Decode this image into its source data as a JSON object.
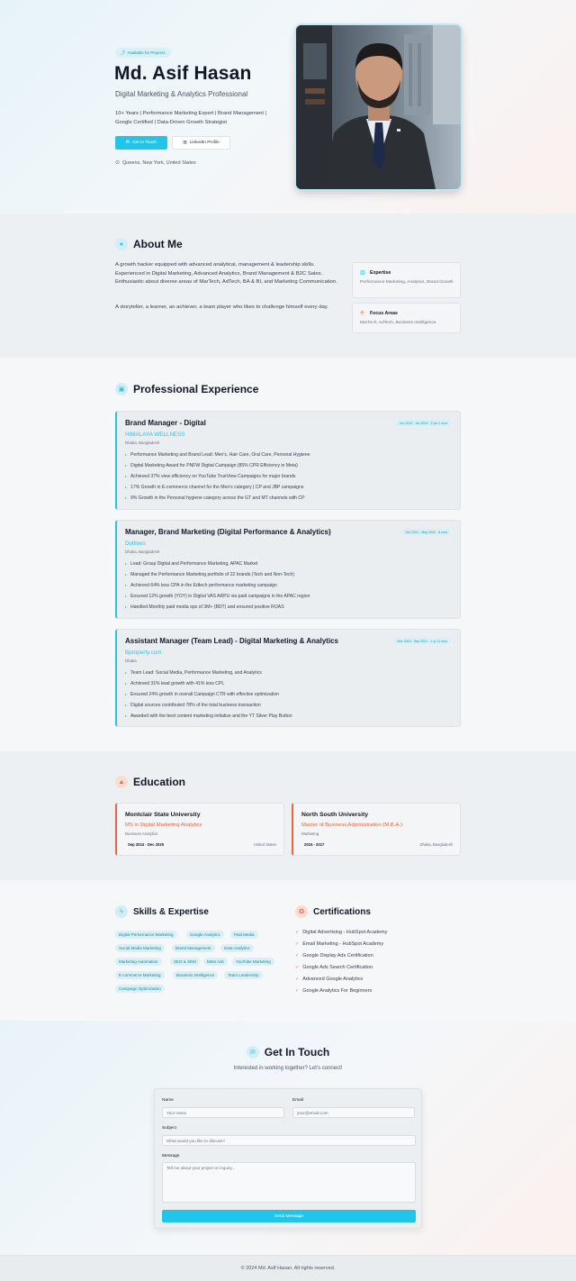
{
  "hero": {
    "badge": "Available for Projects",
    "name": "Md. Asif Hasan",
    "role": "Digital Marketing & Analytics Professional",
    "tagline": "10+ Years | Performance Marketing Expert | Brand Management | Google Certified | Data-Driven Growth Strategist",
    "cta_primary": "Get In Touch",
    "cta_secondary": "LinkedIn Profile",
    "location": "Queens, New York, United States"
  },
  "about": {
    "title": "About Me",
    "p1": "A growth hacker equipped with advanced analytical, management & leadership skills. Experienced in Digital Marketing, Advanced Analytics, Brand Management & B2C Sales. Enthusiastic about diverse areas of MarTech, AdTech, BA & BI, and Marketing Communication.",
    "p2": "A storyteller, a learner, an achiever, a team player who likes to challenge himself every day.",
    "cards": [
      {
        "title": "Expertise",
        "desc": "Performance Marketing, Analytics, Brand Growth"
      },
      {
        "title": "Focus Areas",
        "desc": "MarTech, AdTech, Business Intelligence"
      }
    ]
  },
  "experience": {
    "title": "Professional Experience",
    "jobs": [
      {
        "title": "Brand Manager - Digital",
        "company": "HIMALAYA WELLNESS",
        "location": "Dhaka, Bangladesh",
        "dates": "Jun 2022 - Jul 2024 · 2 yrs 2 mos",
        "bullets": [
          "Performance Marketing and Brand Lead: Men's, Hair Care, Oral Care, Personal Hygiene",
          "Digital Marketing Award for PNFW Digital Campaign (85% CPR Efficiency in Meta)",
          "Achieved 37% view efficiency on YouTube TrueView Campaigns for major brands",
          "17% Growth in E-commerce channel for the Men's category | CP and JBP campaigns",
          "9% Growth in the Personal hygiene category across the GT and MT channels with CP"
        ]
      },
      {
        "title": "Manager, Brand Marketing (Digital Performance & Analytics)",
        "company": "Dotlines",
        "location": "Dhaka, Bangladesh",
        "dates": "Oct 2021 - May 2022 · 8 mos",
        "bullets": [
          "Lead: Group Digital and Performance Marketing, APAC Market",
          "Managed the Performance Marketing portfolio of 22 brands (Tech and Non-Tech)",
          "Achieved 64% less CPA in the Edtech performance marketing campaign",
          "Ensured 12% growth (YOY) in Digital VAS ARPU via paid campaigns in the APAC region",
          "Handled Monthly paid media ops of 3M+ (BDT) and ensured positive ROAS"
        ]
      },
      {
        "title": "Assistant Manager (Team Lead) - Digital Marketing & Analytics",
        "company": "Bproperty.com",
        "location": "Dhaka",
        "dates": "Nov 2019 - Sep 2021 · 1 yr 11 mos",
        "bullets": [
          "Team Lead: Social Media, Performance Marketing, and Analytics",
          "Achieved 31% lead growth with 41% less CPL",
          "Ensured 24% growth in overall Campaign CTR with effective optimization",
          "Digital sources contributed 78% of the total business transaction",
          "Awarded with the best content marketing initiative and the YT Silver Play Button"
        ]
      }
    ]
  },
  "education": {
    "title": "Education",
    "items": [
      {
        "school": "Montclair State University",
        "degree": "MS in Digital Marketing Analytics",
        "field": "Business Analytics",
        "years": "Sep 2024 - Dec 2025",
        "place": "United States"
      },
      {
        "school": "North South University",
        "degree": "Master of Business Administration (M.B.A.)",
        "field": "Marketing",
        "years": "2015 - 2017",
        "place": "Dhaka, Bangladesh"
      }
    ]
  },
  "skills": {
    "title": "Skills & Expertise",
    "items": [
      "Digital Performance Marketing",
      "Google Analytics",
      "Paid Media",
      "Social Media Marketing",
      "Brand Management",
      "Data Analytics",
      "Marketing Automation",
      "SEO & SEM",
      "Meta Ads",
      "YouTube Marketing",
      "E-commerce Marketing",
      "Business Intelligence",
      "Team Leadership",
      "Campaign Optimization"
    ]
  },
  "certifications": {
    "title": "Certifications",
    "items": [
      "Digital Advertising - HubSpot Academy",
      "Email Marketing - HubSpot Academy",
      "Google Display Ads Certification",
      "Google Ads Search Certification",
      "Advanced Google Analytics",
      "Google Analytics For Beginners"
    ]
  },
  "contact": {
    "title": "Get In Touch",
    "subtitle": "Interested in working together? Let's connect!",
    "name_label": "Name",
    "name_placeholder": "Your name",
    "email_label": "Email",
    "email_placeholder": "your@email.com",
    "subject_label": "Subject",
    "subject_placeholder": "What would you like to discuss?",
    "message_label": "Message",
    "message_placeholder": "Tell me about your project or inquiry...",
    "send": "Send Message"
  },
  "footer": {
    "text": "© 2024 Md. Asif Hasan. All rights reserved."
  },
  "colors": {
    "accent": "#22c5ea",
    "secondary": "#f0613e"
  }
}
